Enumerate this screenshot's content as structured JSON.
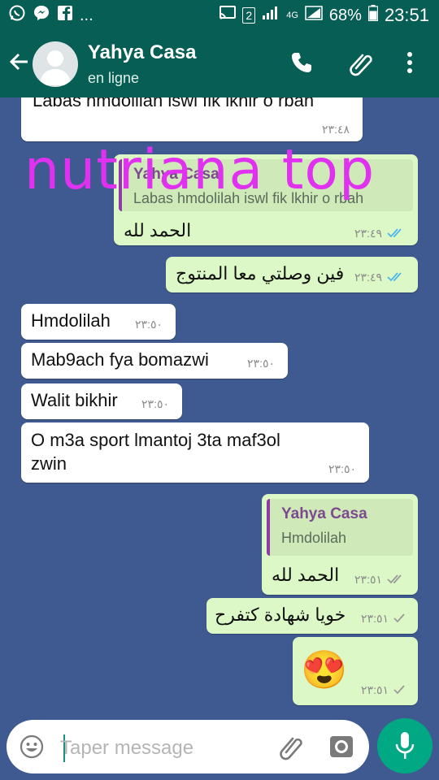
{
  "status_bar": {
    "battery": "68%",
    "time": "23:51",
    "network": "4G",
    "sim": "2",
    "ellipsis": "...",
    "left_icons": [
      "whatsapp-icon",
      "messenger-icon",
      "facebook-icon"
    ],
    "right_icons": [
      "cast-icon",
      "sim-icon",
      "signal-icon",
      "lte-icon",
      "battery-icon"
    ]
  },
  "header": {
    "contact_name": "Yahya Casa",
    "status": "en ligne",
    "icons": [
      "back-arrow-icon",
      "avatar-icon",
      "phone-icon",
      "attach-icon",
      "more-icon"
    ]
  },
  "watermark": "nutriana top",
  "messages": [
    {
      "dir": "in",
      "text": "Labas hmdolilah iswl fik lkhir o rbah",
      "time": "٢٣:٤٨"
    },
    {
      "dir": "out",
      "quote": {
        "name": "Yahya Casa",
        "text": "Labas hmdolilah iswl fik lkhir o rbah"
      },
      "text": "الحمد لله",
      "time": "٢٣:٤٩",
      "status": "read"
    },
    {
      "dir": "out",
      "text": "فين وصلتي معا المنتوج",
      "time": "٢٣:٤٩",
      "status": "read"
    },
    {
      "dir": "in",
      "text": "Hmdolilah",
      "time": "٢٣:٥٠"
    },
    {
      "dir": "in",
      "text": "Mab9ach fya bomazwi",
      "time": "٢٣:٥٠"
    },
    {
      "dir": "in",
      "text": "Walit bikhir",
      "time": "٢٣:٥٠"
    },
    {
      "dir": "in",
      "text_line1": "O m3a sport lmantoj 3ta maf3ol",
      "text_line2": "zwin",
      "time": "٢٣:٥٠"
    },
    {
      "dir": "out",
      "quote": {
        "name": "Yahya Casa",
        "text": "Hmdolilah"
      },
      "text": "الحمد لله",
      "time": "٢٣:٥١",
      "status": "delivered"
    },
    {
      "dir": "out",
      "text": "خويا شهادة كتفرح",
      "time": "٢٣:٥١",
      "status": "sent"
    },
    {
      "dir": "out",
      "emoji": "😍",
      "time": "٢٣:٥١",
      "status": "sent"
    }
  ],
  "input": {
    "placeholder": "Taper message",
    "value": "",
    "icons": [
      "emoji-icon",
      "attach-icon",
      "camera-icon",
      "mic-icon"
    ]
  },
  "colors": {
    "header": "#075E54",
    "chat_background": "#3f5a90",
    "outgoing_bubble": "#dcf8c6",
    "incoming_bubble": "#ffffff",
    "read_ticks": "#4fb6ec",
    "mic_button": "#00a884",
    "watermark": "#e030f0"
  }
}
